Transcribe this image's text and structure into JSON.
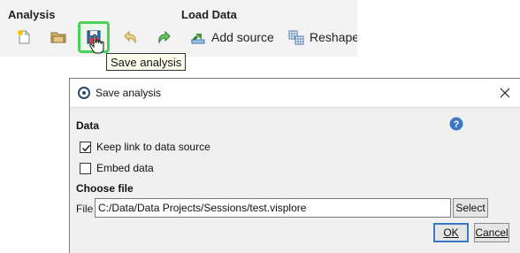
{
  "toolbar": {
    "groups": {
      "analysis": "Analysis",
      "load_data": "Load Data"
    },
    "buttons": {
      "new": {
        "icon": "new-document-icon"
      },
      "open": {
        "icon": "open-folder-icon"
      },
      "save": {
        "icon": "save-icon"
      },
      "undo": {
        "icon": "undo-icon"
      },
      "redo": {
        "icon": "redo-icon"
      },
      "add_source": {
        "label": "Add source",
        "icon": "add-source-icon"
      },
      "reshape": {
        "label": "Reshape",
        "icon": "reshape-icon"
      }
    },
    "tooltip": "Save analysis",
    "highlight_color": "#4cd05a"
  },
  "dialog": {
    "title": "Save analysis",
    "data_section": "Data",
    "keep_link": {
      "label": "Keep link to data source",
      "checked": true
    },
    "embed_data": {
      "label": "Embed data",
      "checked": false
    },
    "choose_file_section": "Choose file",
    "file_label": "File",
    "file_value": "C:/Data/Data Projects/Sessions/test.visplore",
    "select_label": "Select",
    "ok_label": "OK",
    "cancel_label": "Cancel"
  }
}
